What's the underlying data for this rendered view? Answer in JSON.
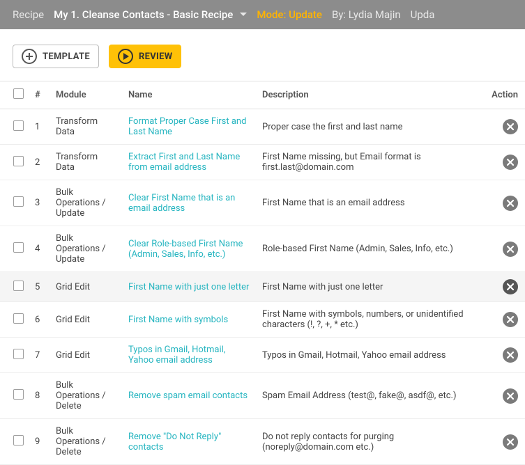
{
  "header": {
    "recipe_label": "Recipe",
    "title": "My 1. Cleanse Contacts - Basic Recipe",
    "mode": "Mode: Update",
    "by": "By: Lydia Majin",
    "upda": "Upda"
  },
  "toolbar": {
    "template_label": "TEMPLATE",
    "review_label": "REVIEW"
  },
  "columns": {
    "num": "#",
    "module": "Module",
    "name": "Name",
    "description": "Description",
    "action": "Action"
  },
  "rows": [
    {
      "num": "1",
      "module": "Transform Data",
      "name": "Format Proper Case First and Last Name",
      "description": "Proper case the first and last name"
    },
    {
      "num": "2",
      "module": "Transform Data",
      "name": "Extract First and Last Name from email address",
      "description": "First Name missing, but Email format is first.last@domain.com"
    },
    {
      "num": "3",
      "module": "Bulk Operations / Update",
      "name": "Clear First Name that is an email address",
      "description": "First Name that is an email address"
    },
    {
      "num": "4",
      "module": "Bulk Operations / Update",
      "name": "Clear Role-based First Name (Admin, Sales, Info, etc.)",
      "description": "Role-based First Name (Admin, Sales, Info, etc.)"
    },
    {
      "num": "5",
      "module": "Grid Edit",
      "name": "First Name with just one letter",
      "description": "First Name with just one letter"
    },
    {
      "num": "6",
      "module": "Grid Edit",
      "name": "First Name with symbols",
      "description": "First Name with symbols, numbers, or unidentified characters (!, ?, +, * etc.)"
    },
    {
      "num": "7",
      "module": "Grid Edit",
      "name": "Typos in Gmail, Hotmail, Yahoo email address",
      "description": "Typos in Gmail, Hotmail, Yahoo email address"
    },
    {
      "num": "8",
      "module": "Bulk Operations / Delete",
      "name": "Remove spam email contacts",
      "description": "Spam Email Address (test@, fake@, asdf@, etc.)"
    },
    {
      "num": "9",
      "module": "Bulk Operations / Delete",
      "name": "Remove \"Do Not Reply\" contacts",
      "description": "Do not reply contacts for purging (noreply@domain.com etc.)"
    }
  ]
}
